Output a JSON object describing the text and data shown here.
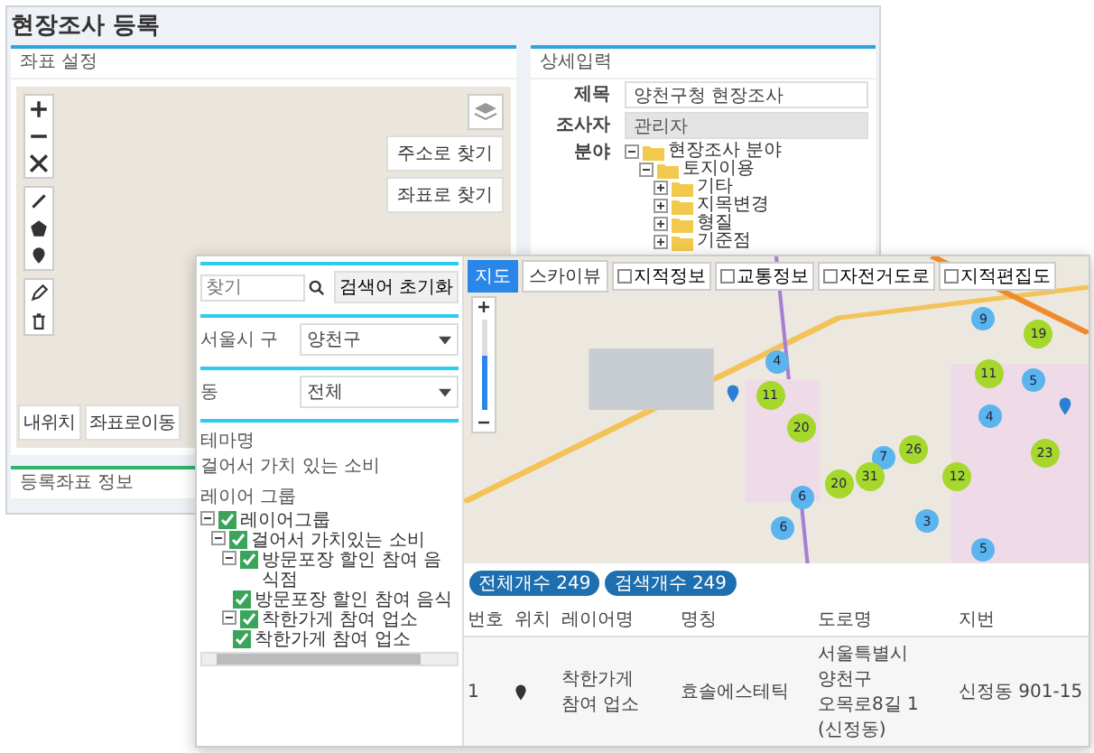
{
  "back_window": {
    "title": "현장조사 등록",
    "coordinate_panel": {
      "title": "좌표 설정",
      "map_buttons": [
        "주소로 찾기",
        "좌표로 찾기"
      ],
      "bottom_buttons": [
        "내위치",
        "좌표로이동"
      ]
    },
    "registered_panel": {
      "title": "등록좌표 정보"
    },
    "detail_panel": {
      "title": "상세입력",
      "fields": [
        {
          "label": "제목",
          "value": "양천구청 현장조사",
          "disabled": false
        },
        {
          "label": "조사자",
          "value": "관리자",
          "disabled": true
        }
      ],
      "category": {
        "label": "분야",
        "tree": [
          {
            "label": "현장조사 분야",
            "expanded": true,
            "children": [
              {
                "label": "토지이용",
                "expanded": true,
                "children": [
                  {
                    "label": "기타",
                    "expanded": false
                  },
                  {
                    "label": "지목변경",
                    "expanded": false
                  },
                  {
                    "label": "형질",
                    "expanded": false
                  },
                  {
                    "label": "기준점",
                    "expanded": false
                  }
                ]
              }
            ]
          }
        ]
      }
    }
  },
  "front_window": {
    "search": {
      "placeholder": "찾기",
      "reset_button": "검색어 초기화"
    },
    "filters": [
      {
        "label": "서울시 구",
        "value": "양천구"
      },
      {
        "label": "동",
        "value": "전체"
      }
    ],
    "theme": {
      "label": "테마명",
      "value": "걸어서 가치 있는 소비"
    },
    "layers": {
      "label": "레이어 그룹",
      "tree": [
        {
          "label": "레이어그룹",
          "checked": true,
          "children": [
            {
              "label": "걸어서 가치있는 소비",
              "checked": true,
              "children": [
                {
                  "label": "방문포장 할인 참여 음식점",
                  "checked": true,
                  "children": [
                    {
                      "label": "방문포장 할인 참여 음식",
                      "checked": true
                    }
                  ]
                },
                {
                  "label": "착한가게 참여 업소",
                  "checked": true,
                  "children": [
                    {
                      "label": "착한가게 참여 업소",
                      "checked": true
                    }
                  ]
                }
              ]
            }
          ]
        }
      ]
    },
    "map": {
      "view_tabs": [
        {
          "label": "지도",
          "selected": true
        },
        {
          "label": "스카이뷰",
          "selected": false
        }
      ],
      "overlays": [
        {
          "label": "지적정보",
          "checked": false
        },
        {
          "label": "교통정보",
          "checked": false
        },
        {
          "label": "자전거도로",
          "checked": false
        },
        {
          "label": "지적편집도",
          "checked": false
        }
      ],
      "zoom": {
        "level": 0.6
      },
      "clusters": [
        {
          "count": "9",
          "color": "#5ab4ee"
        },
        {
          "count": "19",
          "color": "#a5d82a"
        },
        {
          "count": "4",
          "color": "#5ab4ee"
        },
        {
          "count": "11",
          "color": "#a5d82a"
        },
        {
          "count": "5",
          "color": "#5ab4ee"
        },
        {
          "count": "11",
          "color": "#a5d82a"
        },
        {
          "count": "4",
          "color": "#5ab4ee"
        },
        {
          "count": "20",
          "color": "#a5d82a"
        },
        {
          "count": "26",
          "color": "#a5d82a"
        },
        {
          "count": "7",
          "color": "#5ab4ee"
        },
        {
          "count": "23",
          "color": "#a5d82a"
        },
        {
          "count": "31",
          "color": "#a5d82a"
        },
        {
          "count": "12",
          "color": "#a5d82a"
        },
        {
          "count": "20",
          "color": "#a5d82a"
        },
        {
          "count": "6",
          "color": "#5ab4ee"
        },
        {
          "count": "6",
          "color": "#5ab4ee"
        },
        {
          "count": "3",
          "color": "#5ab4ee"
        },
        {
          "count": "5",
          "color": "#5ab4ee"
        }
      ]
    },
    "counts": [
      "전체개수 249",
      "검색개수 249"
    ],
    "table": {
      "columns": [
        "번호",
        "위치",
        "레이어명",
        "명칭",
        "도로명",
        "지번"
      ],
      "rows": [
        {
          "number": "1",
          "layer": "착한가게 참여 업소",
          "name": "효솔에스테틱",
          "road": "서울특별시 양천구 오목로8길 1 (신정동)",
          "lot": "신정동 901-15"
        }
      ]
    }
  }
}
